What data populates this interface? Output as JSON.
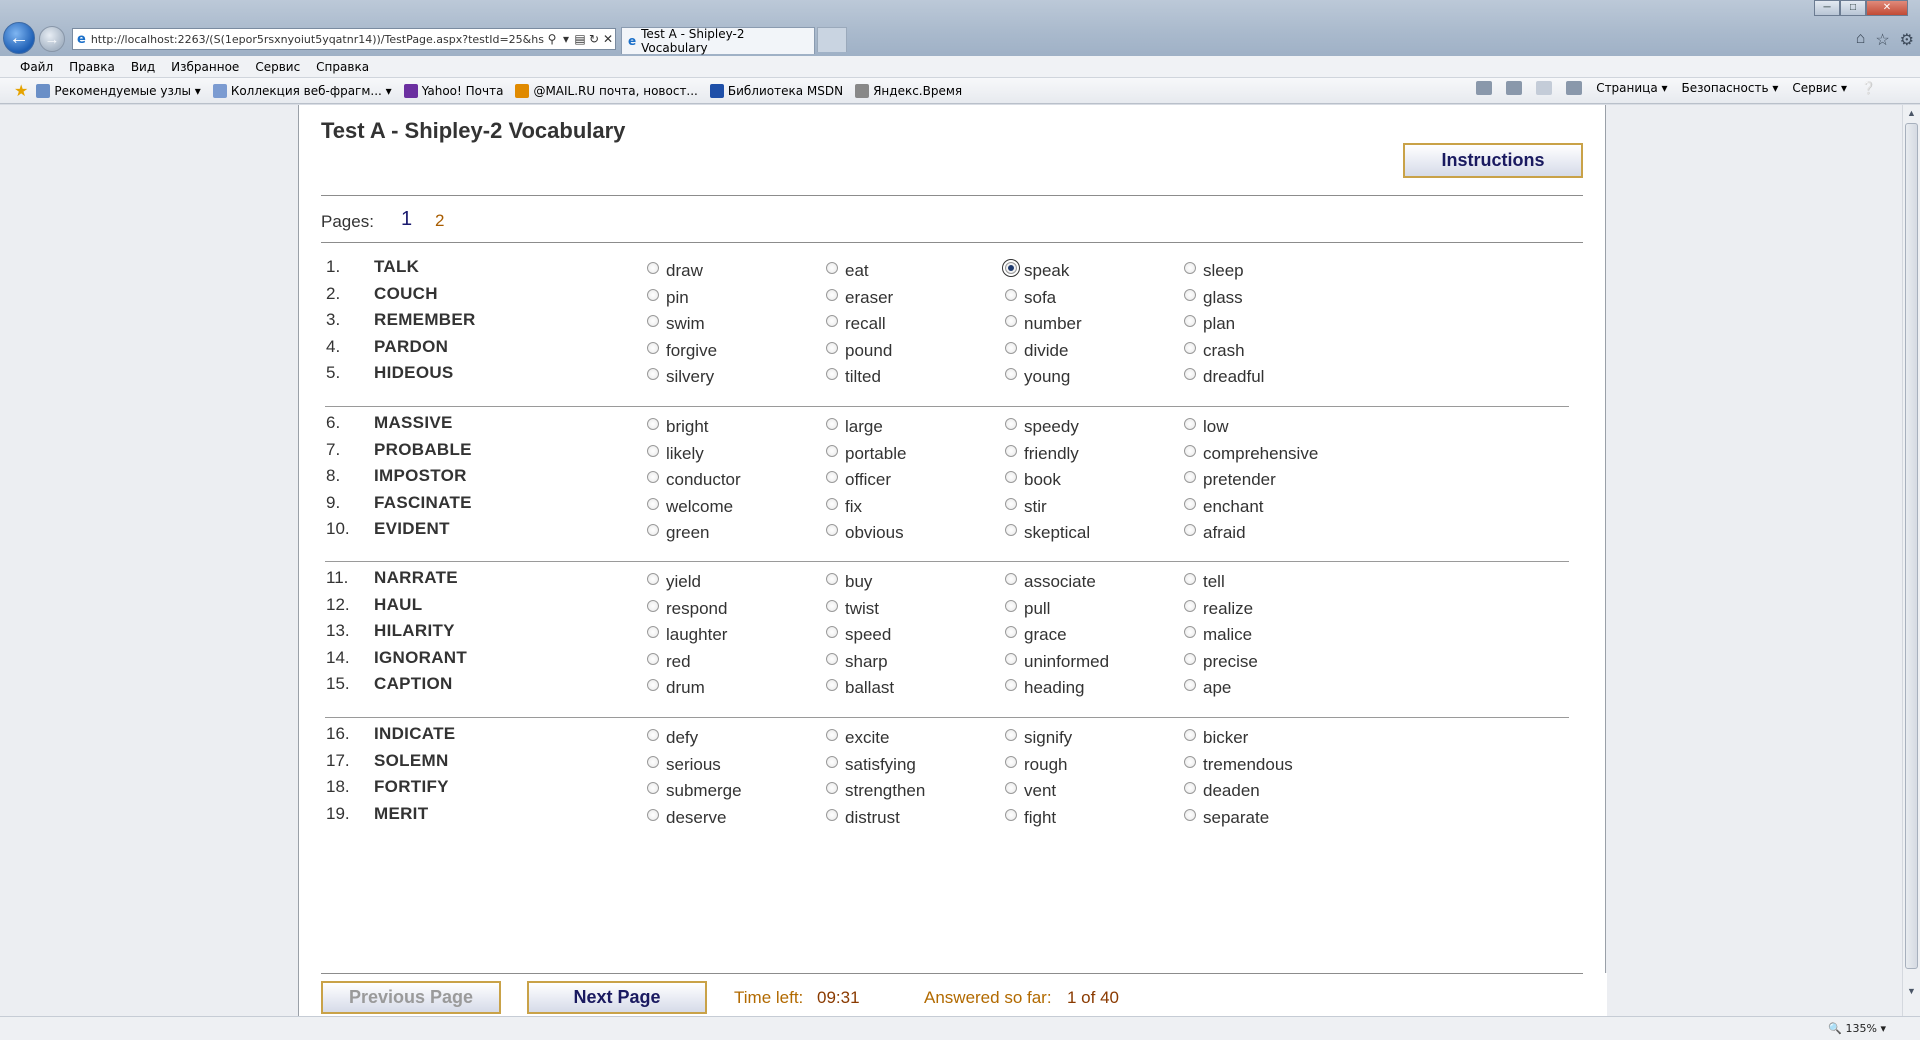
{
  "browser": {
    "url": "http://localhost:2263/(S(1epor5rsxnyoiut5yqatnr14))/TestPage.aspx?testId=25&hs:",
    "tab_title": "Test A - Shipley-2 Vocabulary",
    "menu": [
      "Файл",
      "Правка",
      "Вид",
      "Избранное",
      "Сервис",
      "Справка"
    ],
    "favorites": [
      {
        "label": "Рекомендуемые узлы ▾",
        "color": "#6a8fc7"
      },
      {
        "label": "Коллекция веб-фрагм... ▾",
        "color": "#7b9bd1"
      },
      {
        "label": "Yahoo! Почта",
        "color": "#6b2fa0"
      },
      {
        "label": "@MAIL.RU почта, новост...",
        "color": "#e08a00"
      },
      {
        "label": "Библиотека MSDN",
        "color": "#1e4fa8"
      },
      {
        "label": "Яндекс.Время",
        "color": "#888888"
      }
    ],
    "commands": [
      "Страница ▾",
      "Безопасность ▾",
      "Сервис ▾"
    ],
    "zoom": "135%"
  },
  "page": {
    "title": "Test A - Shipley-2 Vocabulary",
    "instructions_label": "Instructions",
    "pages_label": "Pages:",
    "pages": [
      "1",
      "2"
    ],
    "prev_label": "Previous Page",
    "next_label": "Next Page",
    "time_left_label": "Time left:",
    "time_left": "09:31",
    "answered_label": "Answered so far:",
    "answered": "1 of 40"
  },
  "questions": [
    {
      "num": "1.",
      "word": "TALK",
      "options": [
        "draw",
        "eat",
        "speak",
        "sleep"
      ],
      "selected": 2
    },
    {
      "num": "2.",
      "word": "COUCH",
      "options": [
        "pin",
        "eraser",
        "sofa",
        "glass"
      ],
      "selected": -1
    },
    {
      "num": "3.",
      "word": "REMEMBER",
      "options": [
        "swim",
        "recall",
        "number",
        "plan"
      ],
      "selected": -1
    },
    {
      "num": "4.",
      "word": "PARDON",
      "options": [
        "forgive",
        "pound",
        "divide",
        "crash"
      ],
      "selected": -1
    },
    {
      "num": "5.",
      "word": "HIDEOUS",
      "options": [
        "silvery",
        "tilted",
        "young",
        "dreadful"
      ],
      "selected": -1
    },
    {
      "num": "6.",
      "word": "MASSIVE",
      "options": [
        "bright",
        "large",
        "speedy",
        "low"
      ],
      "selected": -1
    },
    {
      "num": "7.",
      "word": "PROBABLE",
      "options": [
        "likely",
        "portable",
        "friendly",
        "comprehensive"
      ],
      "selected": -1
    },
    {
      "num": "8.",
      "word": "IMPOSTOR",
      "options": [
        "conductor",
        "officer",
        "book",
        "pretender"
      ],
      "selected": -1
    },
    {
      "num": "9.",
      "word": "FASCINATE",
      "options": [
        "welcome",
        "fix",
        "stir",
        "enchant"
      ],
      "selected": -1
    },
    {
      "num": "10.",
      "word": "EVIDENT",
      "options": [
        "green",
        "obvious",
        "skeptical",
        "afraid"
      ],
      "selected": -1
    },
    {
      "num": "11.",
      "word": "NARRATE",
      "options": [
        "yield",
        "buy",
        "associate",
        "tell"
      ],
      "selected": -1
    },
    {
      "num": "12.",
      "word": "HAUL",
      "options": [
        "respond",
        "twist",
        "pull",
        "realize"
      ],
      "selected": -1
    },
    {
      "num": "13.",
      "word": "HILARITY",
      "options": [
        "laughter",
        "speed",
        "grace",
        "malice"
      ],
      "selected": -1
    },
    {
      "num": "14.",
      "word": "IGNORANT",
      "options": [
        "red",
        "sharp",
        "uninformed",
        "precise"
      ],
      "selected": -1
    },
    {
      "num": "15.",
      "word": "CAPTION",
      "options": [
        "drum",
        "ballast",
        "heading",
        "ape"
      ],
      "selected": -1
    },
    {
      "num": "16.",
      "word": "INDICATE",
      "options": [
        "defy",
        "excite",
        "signify",
        "bicker"
      ],
      "selected": -1
    },
    {
      "num": "17.",
      "word": "SOLEMN",
      "options": [
        "serious",
        "satisfying",
        "rough",
        "tremendous"
      ],
      "selected": -1
    },
    {
      "num": "18.",
      "word": "FORTIFY",
      "options": [
        "submerge",
        "strengthen",
        "vent",
        "deaden"
      ],
      "selected": -1
    },
    {
      "num": "19.",
      "word": "MERIT",
      "options": [
        "deserve",
        "distrust",
        "fight",
        "separate"
      ],
      "selected": -1
    }
  ]
}
